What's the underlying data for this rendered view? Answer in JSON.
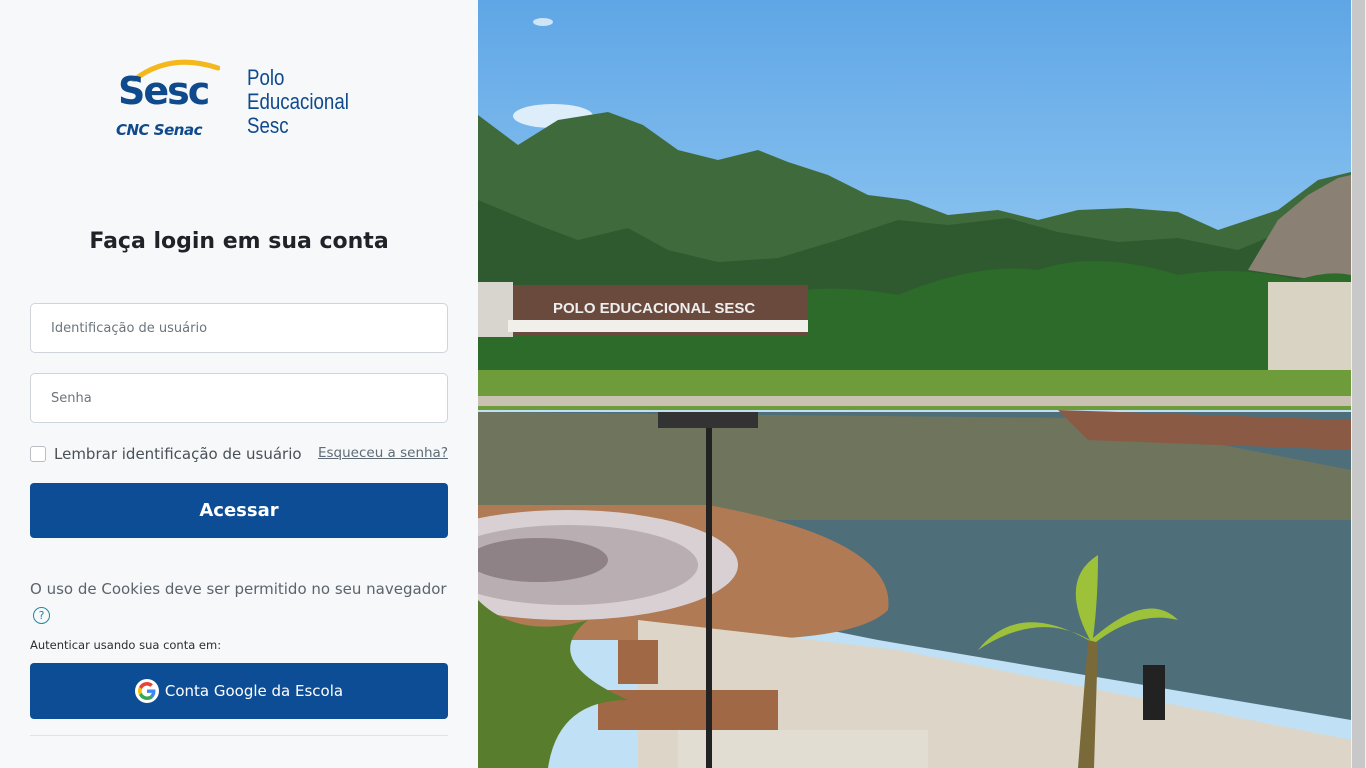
{
  "brand": {
    "logo_word": "Sesc",
    "sub_brands": "CNC Senac",
    "name_lines": [
      "Polo",
      "Educacional",
      "Sesc"
    ]
  },
  "login": {
    "heading": "Faça login em sua conta",
    "username_placeholder": "Identificação de usuário",
    "password_placeholder": "Senha",
    "remember_label": "Lembrar identificação de usuário",
    "forgot_link": "Esqueceu a senha?",
    "submit_label": "Acessar"
  },
  "notice": {
    "cookies_text": "O uso de Cookies deve ser permitido no seu navegador",
    "help_glyph": "?"
  },
  "alt_auth": {
    "label": "Autenticar usando sua conta em:",
    "google_button": "Conta Google da Escola"
  },
  "photo": {
    "building_sign": "POLO EDUCACIONAL SESC"
  },
  "colors": {
    "primary_button": "#0d4d95",
    "brand_blue": "#0f4a8c",
    "brand_yellow": "#f5b81c"
  }
}
